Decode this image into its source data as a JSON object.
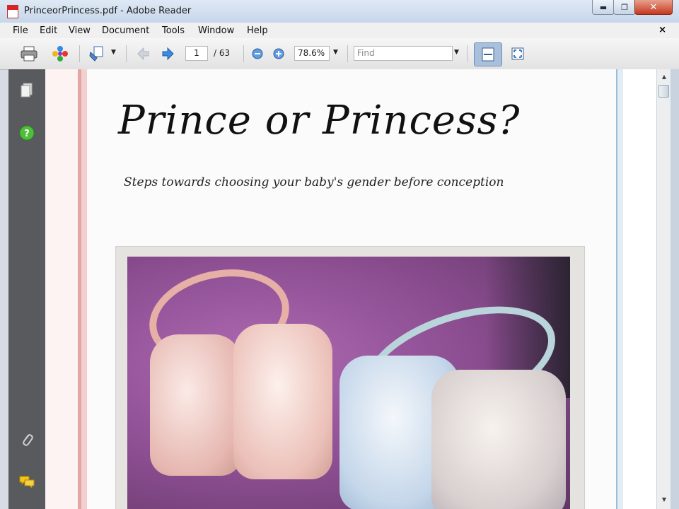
{
  "window": {
    "title": "PrinceorPrincess.pdf - Adobe Reader",
    "min_glyph": "▬",
    "max_glyph": "❐",
    "close_glyph": "✕"
  },
  "menu": {
    "items": [
      "File",
      "Edit",
      "View",
      "Document",
      "Tools",
      "Window",
      "Help"
    ],
    "close_doc": "×"
  },
  "toolbar": {
    "page_current": "1",
    "page_total": "/ 63",
    "zoom": "78.6%",
    "find_placeholder": "Find"
  },
  "document": {
    "title": "Prince or Princess?",
    "subtitle": "Steps towards choosing your baby's gender before conception",
    "photo_icon": "baby-shoes-photo"
  },
  "colors": {
    "nav_panel": "#585a5d",
    "title_bar": "#c7d6ea",
    "close_button": "#c4391e"
  }
}
